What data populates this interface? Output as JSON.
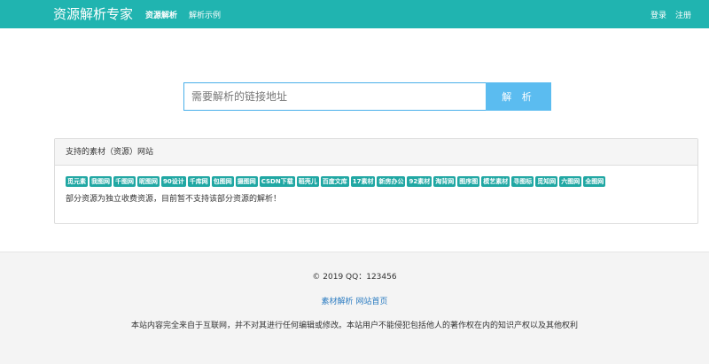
{
  "navbar": {
    "brand": "资源解析专家",
    "links": [
      "资源解析",
      "解析示例"
    ],
    "login": "登录",
    "register": "注册"
  },
  "search": {
    "placeholder": "需要解析的链接地址",
    "button": "解 析"
  },
  "panel": {
    "heading": "支持的素材（资源）网站",
    "tags": [
      "觅元素",
      "我图网",
      "千图网",
      "昵图网",
      "90设计",
      "千库网",
      "包图网",
      "摄图网",
      "CSDN下载",
      "稻壳儿",
      "百度文库",
      "17素材",
      "新房办公",
      "92素材",
      "淘背网",
      "图序图",
      "模艺素材",
      "寻图标",
      "觅知网",
      "六图网",
      "全图网"
    ],
    "note": "部分资源为独立收费资源，目前暂不支持该部分资源的解析！"
  },
  "footer": {
    "copyright": "© 2019 QQ：123456",
    "links": [
      "素材解析",
      "网站首页"
    ],
    "disclaimer": "本站内容完全来自于互联网，并不对其进行任何编辑或修改。本站用户不能侵犯包括他人的著作权在内的知识产权以及其他权利"
  },
  "colors": {
    "navbar": "#20b4b0",
    "button": "#5bbcf0",
    "tag": "#20a7a3",
    "footer_link": "#2a7bc1"
  }
}
